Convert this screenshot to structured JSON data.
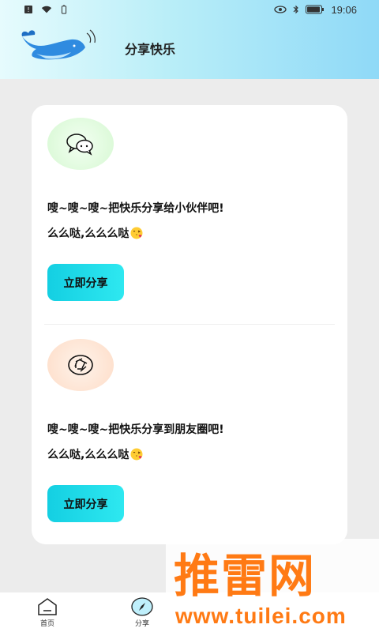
{
  "status_bar": {
    "time": "19:06"
  },
  "header": {
    "title": "分享快乐"
  },
  "shares": [
    {
      "line1": "嗖~嗖~嗖~把快乐分享给小伙伴吧!",
      "line2": "么么哒,么么么哒",
      "button": "立即分享",
      "icon": "wechat-icon"
    },
    {
      "line1": "嗖~嗖~嗖~把快乐分享到朋友圈吧!",
      "line2": "么么哒,么么么哒",
      "button": "立即分享",
      "icon": "moments-icon"
    }
  ],
  "bottom_nav": {
    "items": [
      {
        "label": "首页",
        "icon": "home-icon"
      },
      {
        "label": "分享",
        "icon": "compass-icon"
      }
    ]
  },
  "watermark": {
    "brand": "推雷网",
    "url": "www.tuilei.com"
  },
  "colors": {
    "button_gradient_start": "#14cfe2",
    "button_gradient_end": "#2ee8f0",
    "watermark": "#ff7a14"
  }
}
